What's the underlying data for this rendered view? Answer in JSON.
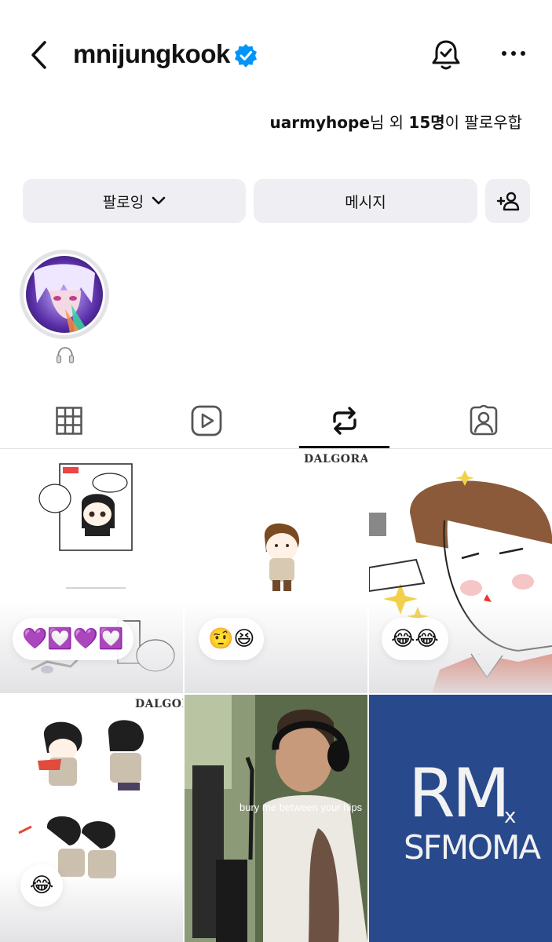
{
  "header": {
    "username": "mnijungkook",
    "verified": true
  },
  "followed_by": {
    "user": "uarmyhope",
    "suffix1": "님 외 ",
    "count": "15명",
    "suffix2": "이 팔로우합"
  },
  "actions": {
    "following_label": "팔로잉",
    "message_label": "메시지"
  },
  "highlights": [
    {
      "label_icon": "headphones-icon"
    }
  ],
  "tabs": [
    {
      "name": "posts",
      "icon": "grid-icon",
      "active": false
    },
    {
      "name": "reels",
      "icon": "play-icon",
      "active": false
    },
    {
      "name": "reposts",
      "icon": "repost-icon",
      "active": true
    },
    {
      "name": "tagged",
      "icon": "tagged-person-icon",
      "active": false
    }
  ],
  "posts": [
    {
      "reply": "💜💟💜💟",
      "watermark": ""
    },
    {
      "reply": "🤨😆",
      "watermark": "DALGORANGORANG"
    },
    {
      "reply": "😂😂",
      "watermark": ""
    },
    {
      "reply": "😂",
      "watermark": "DALGORA"
    },
    {
      "reply": "",
      "caption": "bury me between your hips"
    },
    {
      "reply": "",
      "art_text_1": "RM",
      "art_text_2": "x",
      "art_text_3": "SFMOMA"
    }
  ],
  "colors": {
    "accent_blue": "#0095f6",
    "button_bg": "#efeff3",
    "rm_bg": "#284a8c"
  }
}
